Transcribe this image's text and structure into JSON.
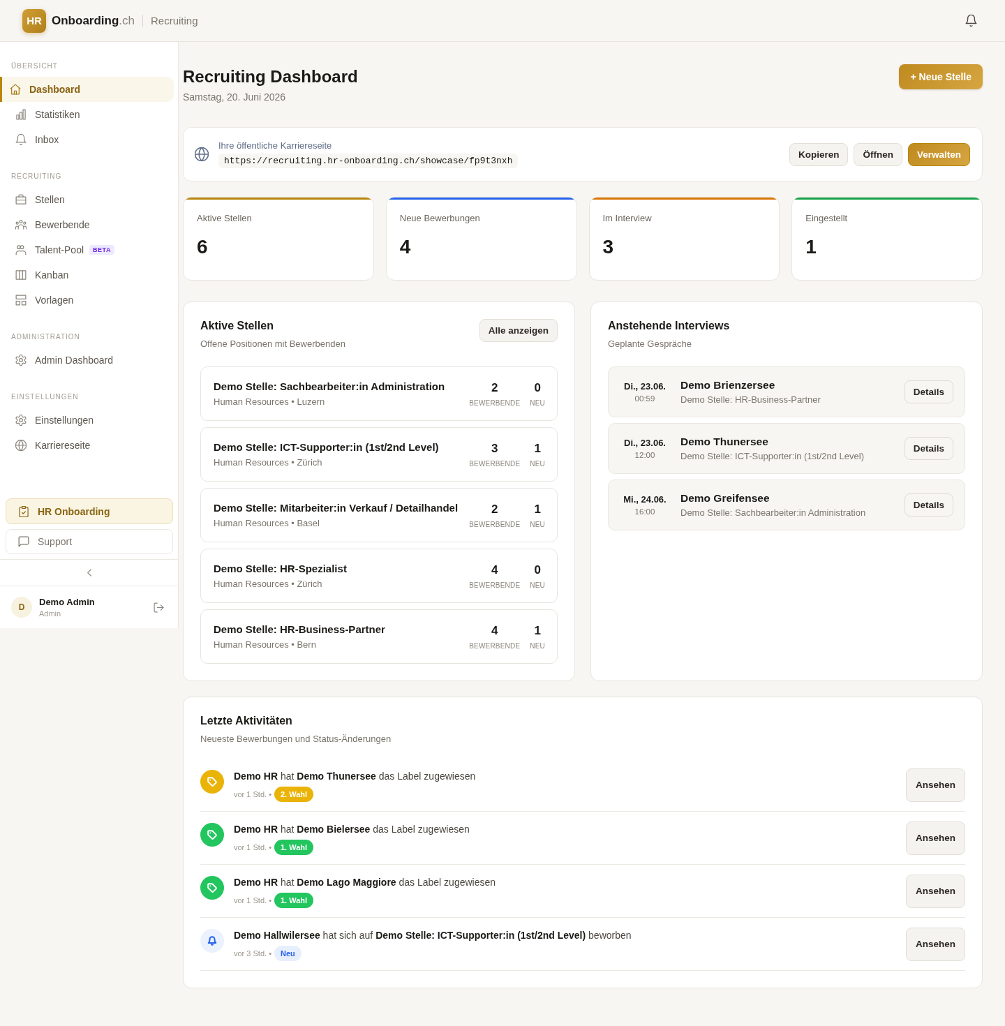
{
  "header": {
    "logo": "HR",
    "brand": "**Onboarding**.ch",
    "section": "Recruiting"
  },
  "sidebar": {
    "sections": [
      {
        "title": "ÜBERSICHT",
        "items": [
          {
            "label": "Dashboard",
            "kind": "home",
            "selected": true
          },
          {
            "label": "Statistiken",
            "kind": "chart",
            "selected": false
          },
          {
            "label": "Inbox",
            "kind": "bell",
            "selected": false
          }
        ]
      },
      {
        "title": "RECRUITING",
        "items": [
          {
            "label": "Stellen",
            "kind": "briefcase",
            "selected": false
          },
          {
            "label": "Bewerbende",
            "kind": "group",
            "selected": false
          },
          {
            "label": "Talent-Pool",
            "kind": "people",
            "selected": false,
            "badge": "BETA"
          },
          {
            "label": "Kanban",
            "kind": "columns",
            "selected": false
          },
          {
            "label": "Vorlagen",
            "kind": "template",
            "selected": false
          }
        ]
      },
      {
        "title": "ADMINISTRATION",
        "items": [
          {
            "label": "Admin Dashboard",
            "kind": "gear",
            "selected": false
          }
        ]
      },
      {
        "title": "EINSTELLUNGEN",
        "items": [
          {
            "label": "Einstellungen",
            "kind": "gear",
            "selected": false
          },
          {
            "label": "Karriereseite",
            "kind": "globe",
            "selected": false
          }
        ]
      }
    ],
    "highlight_link": "HR Onboarding",
    "support_link": "Support",
    "user": {
      "initial": "D",
      "name": "Demo Admin",
      "role": "Admin"
    }
  },
  "page": {
    "title": "Recruiting Dashboard",
    "date": "Samstag, 20. Juni 2026",
    "new_button": "+ Neue Stelle"
  },
  "career_page": {
    "label": "Ihre öffentliche Karriereseite",
    "url": "https://recruiting.hr-onboarding.ch/showcase/fp9t3nxh",
    "buttons": [
      {
        "label": "Kopieren",
        "kind": "secondary"
      },
      {
        "label": "Öffnen",
        "kind": "secondary"
      },
      {
        "label": "Verwalten",
        "kind": "primary"
      }
    ]
  },
  "stats": [
    {
      "label": "Aktive Stellen",
      "value": "6",
      "color": "#b8860b"
    },
    {
      "label": "Neue Bewerbungen",
      "value": "4",
      "color": "#2563eb"
    },
    {
      "label": "Im Interview",
      "value": "3",
      "color": "#d97706"
    },
    {
      "label": "Eingestellt",
      "value": "1",
      "color": "#16a34a"
    }
  ],
  "active_jobs": {
    "title": "Aktive Stellen",
    "subtitle": "Offene Positionen mit Bewerbenden",
    "button": "Alle anzeigen",
    "jobs": [
      {
        "title": "Demo Stelle: Sachbearbeiter:in Administration",
        "meta": "Human Resources • Luzern",
        "applicants": "2",
        "applicants_label": "BEWERBENDE",
        "new": "0",
        "new_label": "NEU"
      },
      {
        "title": "Demo Stelle: ICT-Supporter:in (1st/2nd Level)",
        "meta": "Human Resources • Zürich",
        "applicants": "3",
        "applicants_label": "BEWERBENDE",
        "new": "1",
        "new_label": "NEU"
      },
      {
        "title": "Demo Stelle: Mitarbeiter:in Verkauf / Detailhandel",
        "meta": "Human Resources • Basel",
        "applicants": "2",
        "applicants_label": "BEWERBENDE",
        "new": "1",
        "new_label": "NEU"
      },
      {
        "title": "Demo Stelle: HR-Spezialist",
        "meta": "Human Resources • Zürich",
        "applicants": "4",
        "applicants_label": "BEWERBENDE",
        "new": "0",
        "new_label": "NEU"
      },
      {
        "title": "Demo Stelle: HR-Business-Partner",
        "meta": "Human Resources • Bern",
        "applicants": "4",
        "applicants_label": "BEWERBENDE",
        "new": "1",
        "new_label": "NEU"
      }
    ]
  },
  "interviews": {
    "title": "Anstehende Interviews",
    "subtitle": "Geplante Gespräche",
    "items": [
      {
        "date": "Di., 23.06.",
        "time": "00:59",
        "name": "Demo Brienzersee",
        "job": "Demo Stelle: HR-Business-Partner",
        "button": "Details"
      },
      {
        "date": "Di., 23.06.",
        "time": "12:00",
        "name": "Demo Thunersee",
        "job": "Demo Stelle: ICT-Supporter:in (1st/2nd Level)",
        "button": "Details"
      },
      {
        "date": "Mi., 24.06.",
        "time": "16:00",
        "name": "Demo Greifensee",
        "job": "Demo Stelle: Sachbearbeiter:in Administration",
        "button": "Details"
      }
    ]
  },
  "activities": {
    "title": "Letzte Aktivitäten",
    "subtitle": "Neueste Bewerbungen und Status-Änderungen",
    "items": [
      {
        "icon": {
          "kind": "tag",
          "color": "#eab308"
        },
        "text": "**Demo HR** hat **Demo Thunersee** das Label zugewiesen",
        "time": "vor 1 Std. •",
        "badge": {
          "text": "2. Wahl",
          "kind": "solid",
          "color": "#eab308"
        },
        "button": "Ansehen"
      },
      {
        "icon": {
          "kind": "tag",
          "color": "#22c55e"
        },
        "text": "**Demo HR** hat **Demo Bielersee** das Label zugewiesen",
        "time": "vor 1 Std. •",
        "badge": {
          "text": "1. Wahl",
          "kind": "solid",
          "color": "#22c55e"
        },
        "button": "Ansehen"
      },
      {
        "icon": {
          "kind": "tag",
          "color": "#22c55e"
        },
        "text": "**Demo HR** hat **Demo Lago Maggiore** das Label zugewiesen",
        "time": "vor 1 Std. •",
        "badge": {
          "text": "1. Wahl",
          "kind": "solid",
          "color": "#22c55e"
        },
        "button": "Ansehen"
      },
      {
        "icon": {
          "kind": "bell",
          "color": "#2563eb"
        },
        "text": "**Demo Hallwilersee** hat sich auf **Demo Stelle: ICT-Supporter:in (1st/2nd Level)** beworben",
        "time": "vor 3 Std. •",
        "badge": {
          "text": "Neu",
          "kind": "soft",
          "color": "#2563eb"
        },
        "button": "Ansehen"
      }
    ]
  }
}
